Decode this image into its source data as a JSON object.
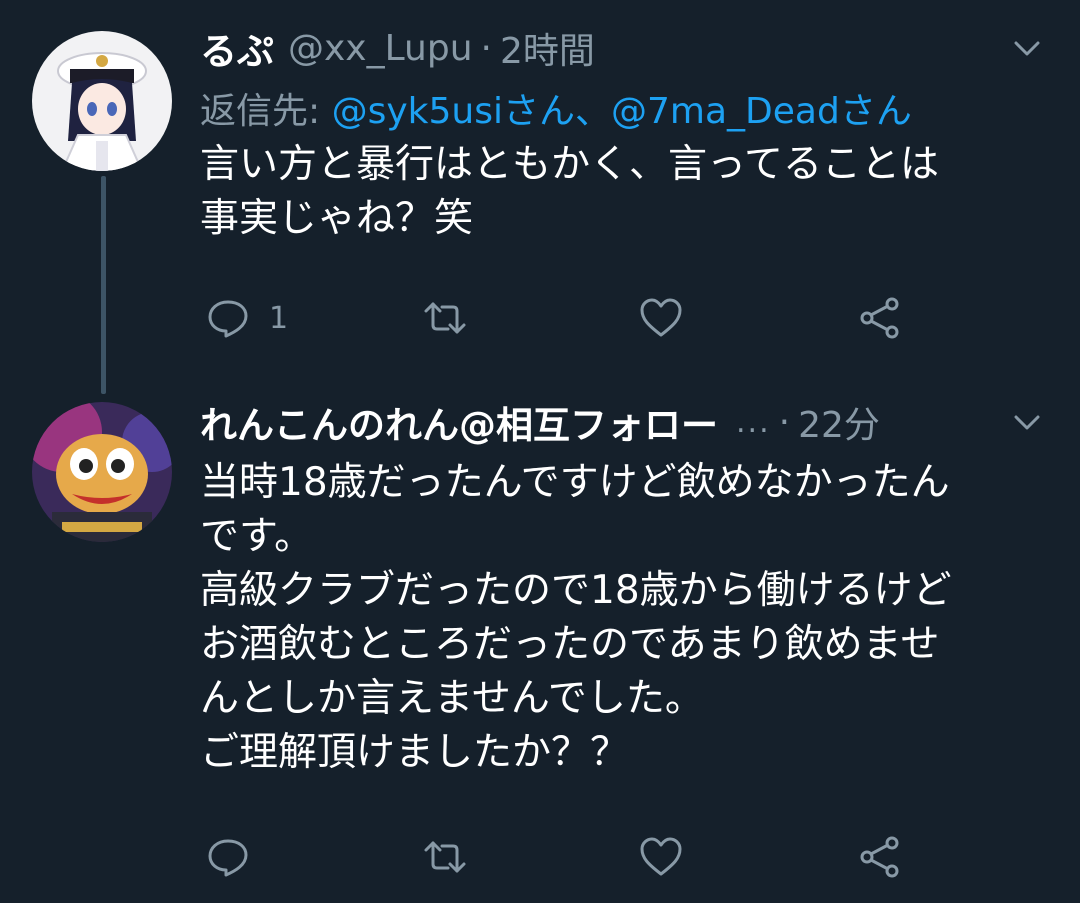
{
  "tweets": [
    {
      "display_name": "るぷ",
      "handle": "@xx_Lupu",
      "separator": "·",
      "time": "2時間",
      "reply_prefix": "返信先:",
      "mention_1": "@syk5usiさん",
      "mention_sep": "、",
      "mention_2": "@7ma_Deadさん",
      "text": "言い方と暴行はともかく、言ってることは\n事実じゃね？笑",
      "reply_count": "1",
      "icons": [
        "reply-icon",
        "retweet-icon",
        "like-icon",
        "share-icon"
      ]
    },
    {
      "display_name": "れんこんのれん@相互フォロー",
      "ellipsis": "...",
      "separator": "·",
      "time": "22分",
      "text": "当時18歳だったんですけど飲めなかったん\nです。\n高級クラブだったので18歳から働けるけど\nお酒飲むところだったのであまり飲めませ\nんとしか言えませんでした。\nご理解頂けましたか？？",
      "reply_count": "",
      "icons": [
        "reply-icon",
        "retweet-icon",
        "like-icon",
        "share-icon"
      ]
    }
  ],
  "colors": {
    "background": "#15202b",
    "text": "#ffffff",
    "secondary": "#8899a6",
    "link": "#1da1f2",
    "thread_line": "#3d5466"
  }
}
